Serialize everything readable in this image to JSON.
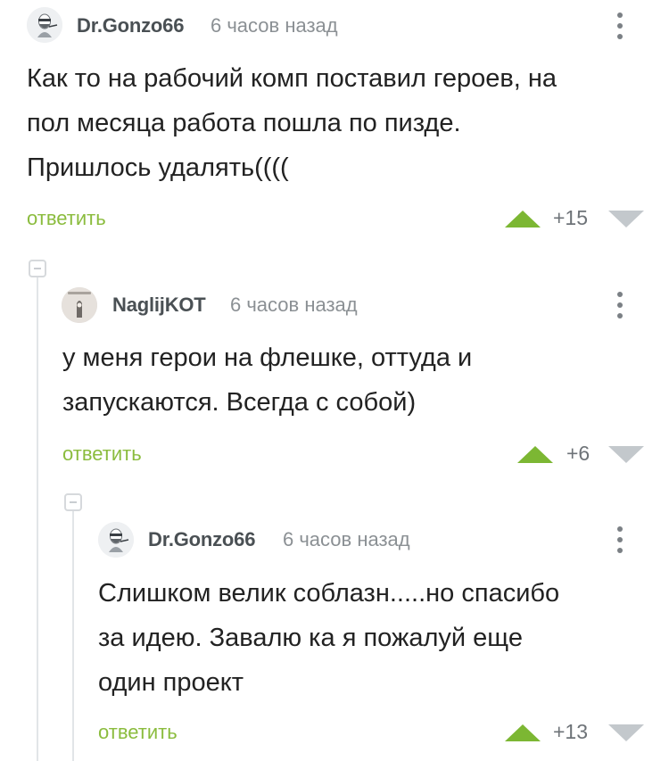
{
  "comments": [
    {
      "author": "Dr.Gonzo66",
      "time": "6 часов назад",
      "text_lines": [
        "Как то на рабочий комп поставил героев, на",
        "пол месяца работа пошла по пизде.",
        "Пришлось удалять(((("
      ],
      "reply_label": "ответить",
      "score": "+15",
      "avatar_icon": "bearded-man-avatar-icon"
    },
    {
      "author": "NaglijKOT",
      "time": "6 часов назад",
      "text_lines": [
        "у меня герои на флешке, оттуда и",
        "запускаются. Всегда с собой)"
      ],
      "reply_label": "ответить",
      "score": "+6",
      "avatar_icon": "cat-avatar-icon"
    },
    {
      "author": "Dr.Gonzo66",
      "time": "6 часов назад",
      "text_lines": [
        "Слишком велик соблазн.....но спасибо",
        "за идею. Завалю ка я пожалуй еще",
        "один проект"
      ],
      "reply_label": "ответить",
      "score": "+13",
      "avatar_icon": "bearded-man-avatar-icon"
    }
  ],
  "colors": {
    "accent_green": "#8bbc3e",
    "upvote_green": "#7cb733",
    "downvote_gray": "#c3c8cc",
    "author_gray": "#4a5054",
    "time_gray": "#8b9094"
  }
}
